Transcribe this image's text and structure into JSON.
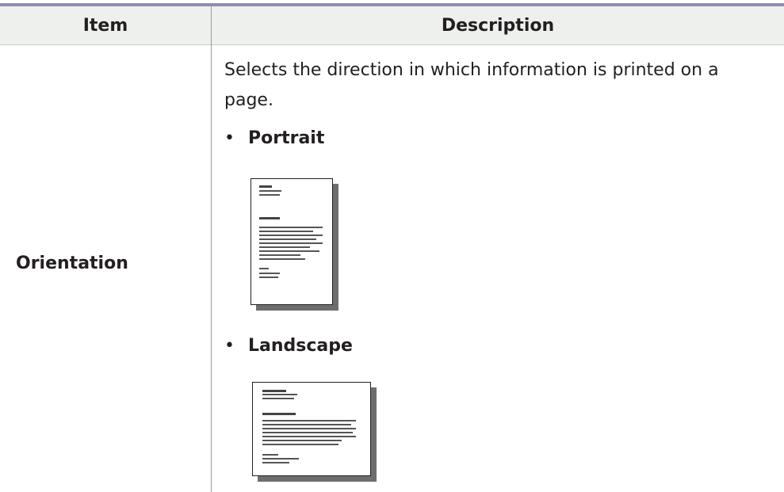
{
  "table": {
    "headers": {
      "item": "Item",
      "description": "Description"
    },
    "rows": [
      {
        "item": "Orientation",
        "description": "Selects the direction in which information is printed on a page.",
        "options": [
          {
            "label": "Portrait",
            "illustration": "portrait-page-icon"
          },
          {
            "label": "Landscape",
            "illustration": "landscape-page-icon"
          }
        ]
      }
    ]
  },
  "colors": {
    "header_background": "#eef0ee",
    "top_rule": "#8c8fb3",
    "text": "#231f20"
  }
}
